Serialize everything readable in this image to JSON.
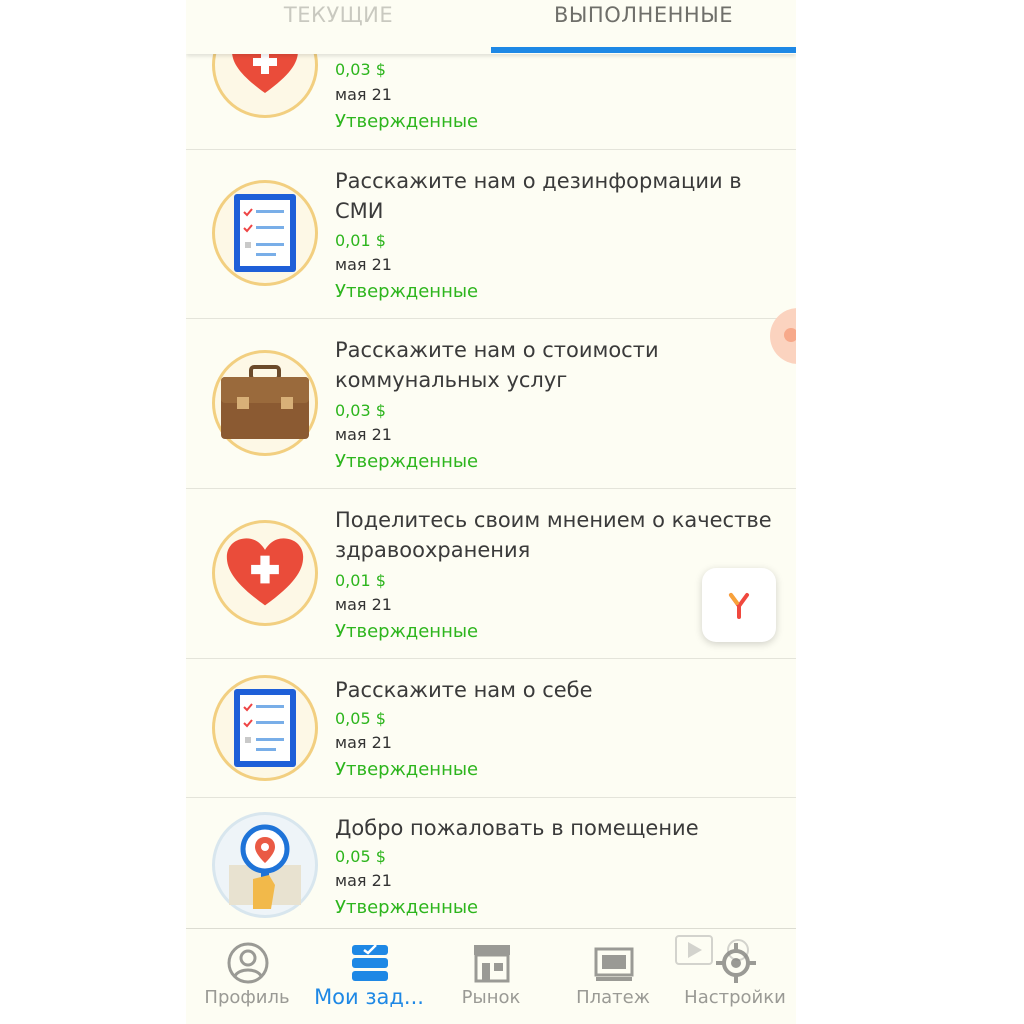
{
  "tabs": {
    "current": "ТЕКУЩИЕ",
    "done": "ВЫПОЛНЕННЫЕ"
  },
  "tasks": [
    {
      "icon": "heart-icon",
      "title": "",
      "price": "0,03 $",
      "date": "мая 21",
      "status": "Утвержденные"
    },
    {
      "icon": "clipboard-icon",
      "title": "Расскажите нам о дезинформации в СМИ",
      "price": "0,01 $",
      "date": "мая 21",
      "status": "Утвержденные"
    },
    {
      "icon": "briefcase-icon",
      "title": "Расскажите нам о стоимости коммунальных услуг",
      "price": "0,03 $",
      "date": "мая 21",
      "status": "Утвержденные"
    },
    {
      "icon": "heart-icon",
      "title": "Поделитесь своим мнением о качестве здравоохранения",
      "price": "0,01 $",
      "date": "мая 21",
      "status": "Утвержденные"
    },
    {
      "icon": "clipboard-icon",
      "title": "Расскажите нам о себе",
      "price": "0,05 $",
      "date": "мая 21",
      "status": "Утвержденные"
    },
    {
      "icon": "location-magnifier-icon",
      "title": "Добро пожаловать в помещение",
      "price": "0,05 $",
      "date": "мая 21",
      "status": "Утвержденные"
    }
  ],
  "bottom_nav": [
    {
      "icon": "profile-icon",
      "label": "Профиль"
    },
    {
      "icon": "tasks-icon",
      "label": "Мои зад..."
    },
    {
      "icon": "store-icon",
      "label": "Рынок"
    },
    {
      "icon": "payment-icon",
      "label": "Платеж"
    },
    {
      "icon": "settings-icon",
      "label": "Настройки"
    }
  ],
  "colors": {
    "accent": "#1e88e5",
    "approved": "#2db51d",
    "background": "#fdfdf3"
  }
}
